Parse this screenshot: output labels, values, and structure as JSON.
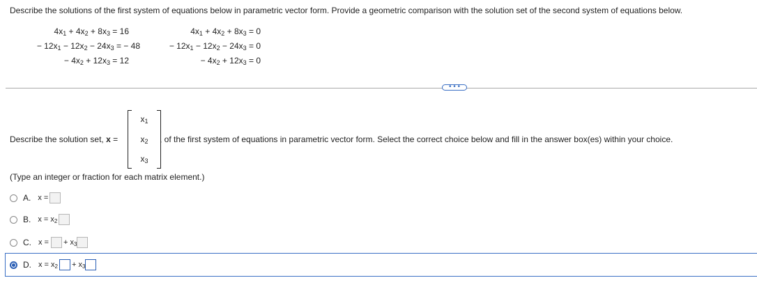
{
  "prompt": "Describe the solutions of the first system of equations below in parametric vector form. Provide a geometric comparison with the solution set of the second system of equations below.",
  "system1": {
    "eq1": {
      "a": "4x",
      "b": " + 4x",
      "c": " + 8x",
      "rhs": " = 16"
    },
    "eq2": {
      "a": "− 12x",
      "b": " − 12x",
      "c": " − 24x",
      "rhs": " = − 48"
    },
    "eq3": {
      "b": "− 4x",
      "c": " + 12x",
      "rhs": " = 12"
    }
  },
  "system2": {
    "eq1": {
      "a": "4x",
      "b": " + 4x",
      "c": " + 8x",
      "rhs": " = 0"
    },
    "eq2": {
      "a": "− 12x",
      "b": " − 12x",
      "c": " − 24x",
      "rhs": " = 0"
    },
    "eq3": {
      "b": "− 4x",
      "c": " + 12x",
      "rhs": " = 0"
    }
  },
  "subs": {
    "one": "1",
    "two": "2",
    "three": "3"
  },
  "more_button": "• • •",
  "describe": {
    "before": "Describe the solution set, ",
    "bold_x": "x",
    "equals": " =",
    "matrix_var": "x",
    "after": ", of the first system of equations in parametric vector form. Select the correct choice below and fill in the answer box(es) within your choice."
  },
  "hint": "(Type an integer or fraction for each matrix element.)",
  "options": {
    "a": {
      "letter": "A.",
      "lhs": "x ="
    },
    "b": {
      "letter": "B.",
      "lhs": "x = x"
    },
    "c": {
      "letter": "C.",
      "lhs": "x =",
      "plus": "+ x"
    },
    "d": {
      "letter": "D.",
      "lhs": "x = x",
      "plus": "+ x"
    }
  },
  "selected_option": "D",
  "colors": {
    "accent": "#2b5fb5",
    "divider": "#a9a9a9"
  }
}
